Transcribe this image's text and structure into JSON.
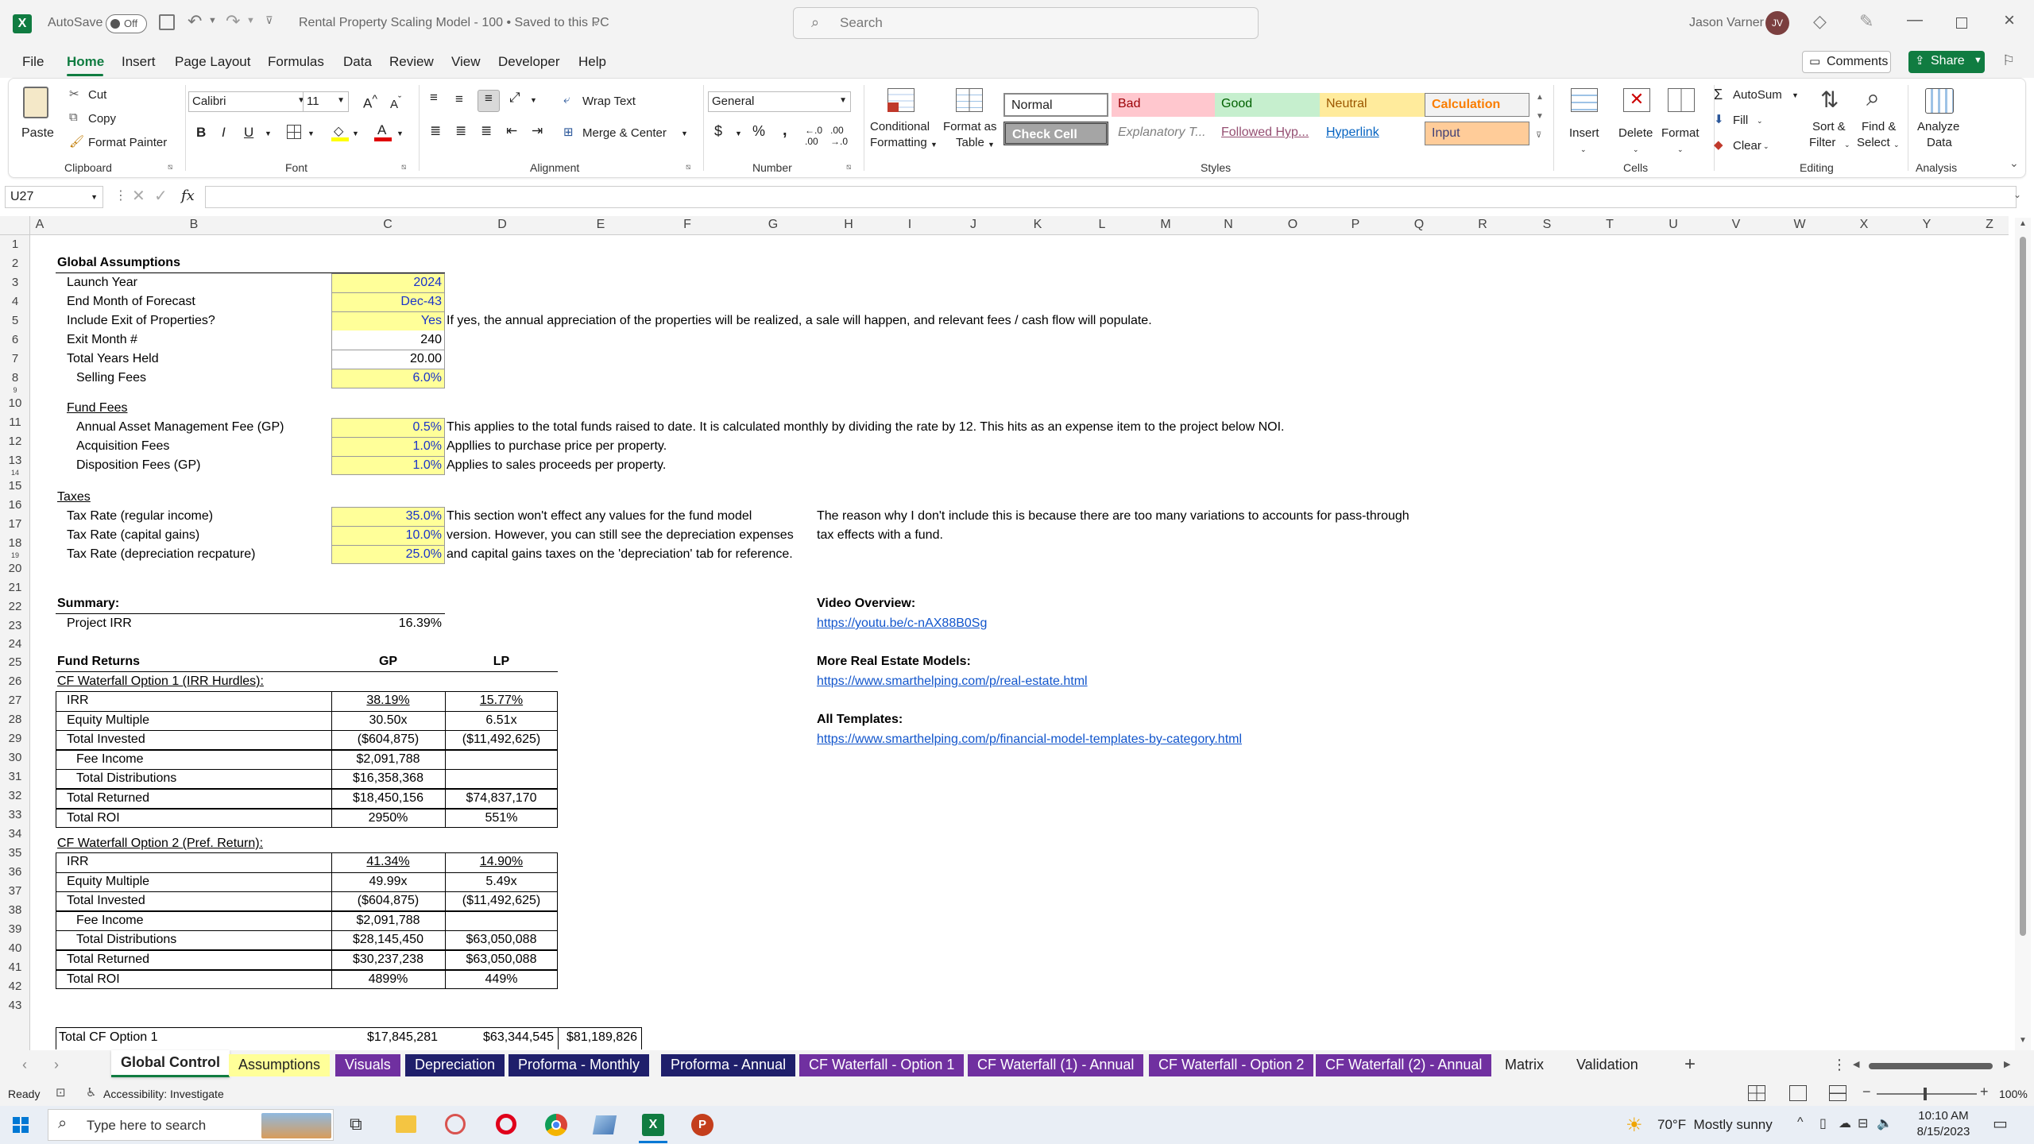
{
  "titlebar": {
    "autosave_label": "AutoSave",
    "autosave_state": "Off",
    "filename": "Rental Property Scaling Model - 100 • Saved to this PC",
    "search_placeholder": "Search",
    "user_name": "Jason Varner",
    "user_initials": "JV"
  },
  "menu": {
    "items": [
      "File",
      "Home",
      "Insert",
      "Page Layout",
      "Formulas",
      "Data",
      "Review",
      "View",
      "Developer",
      "Help"
    ],
    "active": "Home",
    "comments": "Comments",
    "share": "Share"
  },
  "ribbon": {
    "clipboard": {
      "paste": "Paste",
      "cut": "Cut",
      "copy": "Copy",
      "format_painter": "Format Painter",
      "group": "Clipboard"
    },
    "font": {
      "name": "Calibri",
      "size": "11",
      "bold": "B",
      "italic": "I",
      "underline": "U",
      "group": "Font"
    },
    "alignment": {
      "wrap": "Wrap Text",
      "merge": "Merge & Center",
      "group": "Alignment"
    },
    "number": {
      "format": "General",
      "group": "Number"
    },
    "styles": {
      "conditional_1": "Conditional",
      "conditional_2": "Formatting",
      "table_1": "Format as",
      "table_2": "Table",
      "normal": "Normal",
      "bad": "Bad",
      "good": "Good",
      "neutral": "Neutral",
      "calculation": "Calculation",
      "check": "Check Cell",
      "explanatory": "Explanatory T...",
      "followed": "Followed Hyp...",
      "hyperlink": "Hyperlink",
      "input": "Input",
      "group": "Styles"
    },
    "cells": {
      "insert": "Insert",
      "delete": "Delete",
      "format": "Format",
      "group": "Cells"
    },
    "editing": {
      "autosum": "AutoSum",
      "fill": "Fill",
      "clear": "Clear",
      "sort_1": "Sort &",
      "sort_2": "Filter",
      "find_1": "Find &",
      "find_2": "Select",
      "group": "Editing"
    },
    "analysis": {
      "analyze_1": "Analyze",
      "analyze_2": "Data",
      "group": "Analysis"
    }
  },
  "formula_bar": {
    "name_box": "U27",
    "fx": "fx",
    "content": ""
  },
  "columns": [
    "A",
    "B",
    "C",
    "D",
    "E",
    "F",
    "G",
    "H",
    "I",
    "J",
    "K",
    "L",
    "M",
    "N",
    "O",
    "P",
    "Q",
    "R",
    "S",
    "T",
    "U",
    "V",
    "W",
    "X",
    "Y",
    "Z"
  ],
  "rows": [
    "1",
    "2",
    "3",
    "4",
    "5",
    "6",
    "7",
    "8",
    "9",
    "10",
    "11",
    "12",
    "13",
    "14",
    "15",
    "16",
    "17",
    "18",
    "19",
    "20",
    "21",
    "22",
    "23",
    "24",
    "25",
    "26",
    "27",
    "28",
    "29",
    "30",
    "31",
    "32",
    "33",
    "34",
    "35",
    "36",
    "37",
    "38",
    "39",
    "40",
    "41",
    "42",
    "43"
  ],
  "sheet": {
    "global_title": "Global Assumptions",
    "launch_year_label": "Launch Year",
    "launch_year": "2024",
    "end_month_label": "End Month of Forecast",
    "end_month": "Dec-43",
    "exit_label": "Include Exit of Properties?",
    "exit_value": "Yes",
    "exit_note": "If yes, the annual appreciation of the properties will be realized, a sale will happen, and relevant fees / cash flow will populate.",
    "exit_month_label": "Exit Month #",
    "exit_month": "240",
    "years_held_label": "Total Years Held",
    "years_held": "20.00",
    "selling_fees_label": "Selling Fees",
    "selling_fees": "6.0%",
    "fund_fees_title": "Fund Fees",
    "amf_label": "Annual Asset Management Fee (GP)",
    "amf_value": "0.5%",
    "amf_note": "This applies to the total funds raised to date. It is calculated monthly by dividing the rate by 12. This hits as an expense item to the project below NOI.",
    "acq_label": "Acquisition Fees",
    "acq_value": "1.0%",
    "acq_note": "Appllies to purchase price per property.",
    "disp_label": "Disposition Fees (GP)",
    "disp_value": "1.0%",
    "disp_note": "Applies to sales proceeds per property.",
    "taxes_title": "Taxes",
    "tax_reg_label": "Tax Rate (regular income)",
    "tax_reg": "35.0%",
    "tax_cg_label": "Tax Rate (capital gains)",
    "tax_cg": "10.0%",
    "tax_dep_label": "Tax Rate (depreciation recpature)",
    "tax_dep": "25.0%",
    "tax_note_1": "This section won't effect any values for the fund model",
    "tax_note_2": "version. However, you can still see the depreciation expenses",
    "tax_note_3": "and capital gains taxes on the 'depreciation' tab for reference.",
    "tax_reason_1": "The reason why I don't include this is because there are too many variations to accounts for pass-through",
    "tax_reason_2": "tax effects with a fund.",
    "summary_title": "Summary:",
    "irr_label": "Project IRR",
    "irr_value": "16.39%",
    "fund_returns": "Fund Returns",
    "gp": "GP",
    "lp": "LP",
    "opt1_title": "CF Waterfall Option 1 (IRR Hurdles):",
    "opt1_rows": [
      {
        "label": "IRR",
        "gp": "38.19%",
        "lp": "15.77%"
      },
      {
        "label": "Equity Multiple",
        "gp": "30.50x",
        "lp": "6.51x"
      },
      {
        "label": "Total Invested",
        "gp": "($604,875)",
        "lp": "($11,492,625)"
      },
      {
        "label": "Fee Income",
        "gp": "$2,091,788",
        "lp": ""
      },
      {
        "label": "Total Distributions",
        "gp": "$16,358,368",
        "lp": ""
      },
      {
        "label": "Total Returned",
        "gp": "$18,450,156",
        "lp": "$74,837,170"
      },
      {
        "label": "Total ROI",
        "gp": "2950%",
        "lp": "551%"
      }
    ],
    "opt2_title": "CF Waterfall Option 2 (Pref. Return):",
    "opt2_rows": [
      {
        "label": "IRR",
        "gp": "41.34%",
        "lp": "14.90%"
      },
      {
        "label": "Equity Multiple",
        "gp": "49.99x",
        "lp": "5.49x"
      },
      {
        "label": "Total Invested",
        "gp": "($604,875)",
        "lp": "($11,492,625)"
      },
      {
        "label": "Fee Income",
        "gp": "$2,091,788",
        "lp": ""
      },
      {
        "label": "Total Distributions",
        "gp": "$28,145,450",
        "lp": "$63,050,088"
      },
      {
        "label": "Total Returned",
        "gp": "$30,237,238",
        "lp": "$63,050,088"
      },
      {
        "label": "Total ROI",
        "gp": "4899%",
        "lp": "449%"
      }
    ],
    "total_opt1_label": "Total CF Option 1",
    "total_gp": "$17,845,281",
    "total_lp": "$63,344,545",
    "total_all": "$81,189,826",
    "video_title": "Video Overview:",
    "video_link": "https://youtu.be/c-nAX88B0Sg",
    "more_title": "More Real Estate Models:",
    "more_link": "https://www.smarthelping.com/p/real-estate.html",
    "templates_title": "All Templates:",
    "templates_link": "https://www.smarthelping.com/p/financial-model-templates-by-category.html"
  },
  "tabs": [
    {
      "label": "Global Control",
      "bg": "#ffffff",
      "fg": "#222222"
    },
    {
      "label": "Assumptions",
      "bg": "#ffff99",
      "fg": "#222222"
    },
    {
      "label": "Visuals",
      "bg": "#7030a0",
      "fg": "#ffffff"
    },
    {
      "label": "Depreciation",
      "bg": "#1f1f6b",
      "fg": "#ffffff"
    },
    {
      "label": "Proforma - Monthly",
      "bg": "#1f1f6b",
      "fg": "#ffffff"
    },
    {
      "label": "Proforma - Annual",
      "bg": "#1f1f6b",
      "fg": "#ffffff"
    },
    {
      "label": "CF Waterfall - Option 1",
      "bg": "#7030a0",
      "fg": "#ffffff"
    },
    {
      "label": "CF Waterfall (1) - Annual",
      "bg": "#7030a0",
      "fg": "#ffffff"
    },
    {
      "label": "CF Waterfall - Option 2",
      "bg": "#7030a0",
      "fg": "#ffffff"
    },
    {
      "label": "CF Waterfall (2) - Annual",
      "bg": "#7030a0",
      "fg": "#ffffff"
    },
    {
      "label": "Matrix",
      "bg": "#f3f3f3",
      "fg": "#222222"
    },
    {
      "label": "Validation",
      "bg": "#f3f3f3",
      "fg": "#222222"
    }
  ],
  "status": {
    "ready": "Ready",
    "accessibility": "Accessibility: Investigate",
    "zoom": "100%"
  },
  "taskbar": {
    "search_placeholder": "Type here to search",
    "weather": "70°F  Mostly sunny",
    "time": "10:10 AM",
    "date": "8/15/2023"
  },
  "colors": {
    "excel_green": "#107c41",
    "input_yellow": "#ffff99",
    "purple_tab": "#7030a0",
    "navy_tab": "#1f1f6b",
    "link_blue": "#1155cc"
  }
}
